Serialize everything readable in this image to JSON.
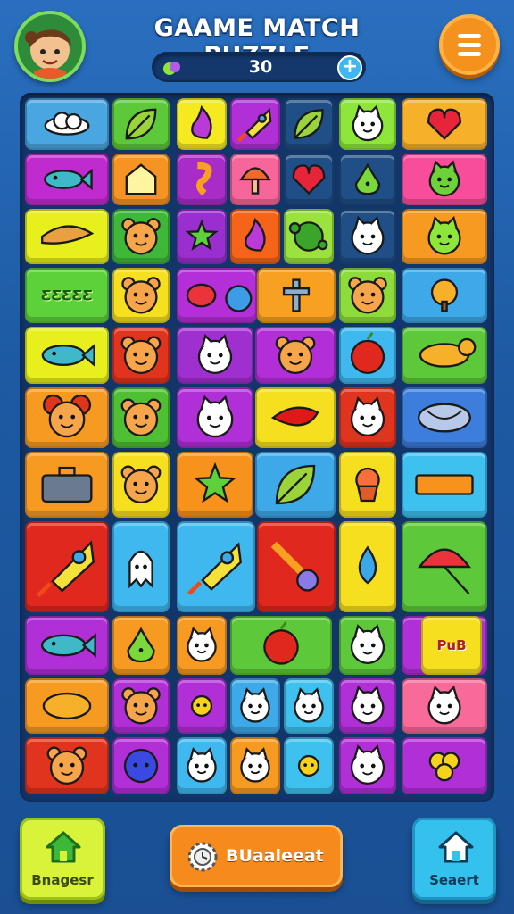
{
  "header": {
    "title": "GAAME MATCH PUZZLE",
    "score": "30",
    "avatar_icon": "cartoon-girl-avatar-icon",
    "menu_icon": "hamburger-menu-icon",
    "add_icon": "plus-icon"
  },
  "colors": {
    "background": "#1f5fa8",
    "board": "#12356a",
    "menu_button": "#f5921e",
    "left_button": "#d9f23a",
    "center_button": "#f78a1c",
    "right_button": "#35c1ee"
  },
  "board": {
    "tiles": [
      {
        "row": 0,
        "color": "#4aa6e0",
        "icon": "cloud-icon"
      },
      {
        "row": 0,
        "color": "#5dc93a",
        "icon": "leaf-icon"
      },
      {
        "row": 0,
        "color": "#f4ea1f",
        "icon": "flame-icon"
      },
      {
        "row": 0,
        "color": "#b02fd6",
        "icon": "rocket-icon"
      },
      {
        "row": 0,
        "color": "#1f4f86",
        "icon": "leaf-icon"
      },
      {
        "row": 0,
        "color": "#8ee63a",
        "icon": "cat-face-icon"
      },
      {
        "row": 0,
        "color": "#f7b02a",
        "icon": "heart-icon"
      },
      {
        "row": 1,
        "color": "#c02bd0",
        "icon": "fish-icon"
      },
      {
        "row": 1,
        "color": "#f59422",
        "icon": "house-icon"
      },
      {
        "row": 1,
        "color": "#a82cc8",
        "icon": "seahorse-icon"
      },
      {
        "row": 1,
        "color": "#f7669a",
        "icon": "mushroom-icon"
      },
      {
        "row": 1,
        "color": "#1f4f86",
        "icon": "heart-icon"
      },
      {
        "row": 1,
        "color": "#1f4f86",
        "icon": "pear-icon"
      },
      {
        "row": 1,
        "color": "#f74d9a",
        "icon": "frog-face-icon"
      },
      {
        "row": 2,
        "color": "#e7f01c",
        "icon": "banana-icon"
      },
      {
        "row": 2,
        "color": "#3fb83a",
        "icon": "bear-face-icon"
      },
      {
        "row": 2,
        "color": "#9a2fd0",
        "icon": "star-icon"
      },
      {
        "row": 2,
        "color": "#f56418",
        "icon": "flame-icon"
      },
      {
        "row": 2,
        "color": "#9be23f",
        "icon": "splash-icon"
      },
      {
        "row": 2,
        "color": "#1f4f86",
        "icon": "ghost-face-icon"
      },
      {
        "row": 2,
        "color": "#f79a22",
        "icon": "monster-face-icon"
      },
      {
        "row": 3,
        "color": "#5dd13a",
        "icon": "text-tile",
        "text": "ƸƸƸƸƸ"
      },
      {
        "row": 3,
        "color": "#f6df1f",
        "icon": "bear-face-icon"
      },
      {
        "row": 3,
        "color": "#b52fd8",
        "icon": "balloon-icon"
      },
      {
        "row": 3,
        "color": "#f7a021",
        "icon": "cross-icon"
      },
      {
        "row": 3,
        "color": "#8edc3c",
        "icon": "bear-face-icon"
      },
      {
        "row": 3,
        "color": "#3da9e8",
        "icon": "tree-icon"
      },
      {
        "row": 4,
        "color": "#e7f01c",
        "icon": "fish-icon"
      },
      {
        "row": 4,
        "color": "#e0341e",
        "icon": "bear-face-icon"
      },
      {
        "row": 4,
        "color": "#a02fd0",
        "icon": "ghost-face-icon"
      },
      {
        "row": 4,
        "color": "#b22fd8",
        "icon": "bear-face-icon"
      },
      {
        "row": 4,
        "color": "#3fb8ef",
        "icon": "apple-icon"
      },
      {
        "row": 4,
        "color": "#5dc93a",
        "icon": "dog-icon"
      },
      {
        "row": 5,
        "color": "#f79a22",
        "icon": "mouse-face-icon"
      },
      {
        "row": 5,
        "color": "#4fbf34",
        "icon": "bear-face-icon"
      },
      {
        "row": 5,
        "color": "#b02fd6",
        "icon": "cat-face-icon"
      },
      {
        "row": 5,
        "color": "#f6df1f",
        "icon": "chili-icon"
      },
      {
        "row": 5,
        "color": "#e0341e",
        "icon": "cat-face-icon"
      },
      {
        "row": 5,
        "color": "#3d7ddb",
        "icon": "yarn-icon"
      },
      {
        "row": 6,
        "color": "#f79a22",
        "icon": "briefcase-icon"
      },
      {
        "row": 6,
        "color": "#f6df1f",
        "icon": "bear-face-icon"
      },
      {
        "row": 6,
        "color": "#f7931c",
        "icon": "star-icon"
      },
      {
        "row": 6,
        "color": "#3da9e8",
        "icon": "leaf-icon"
      },
      {
        "row": 6,
        "color": "#f6df1f",
        "icon": "cupcake-icon"
      },
      {
        "row": 6,
        "color": "#3fc1ef",
        "icon": "sign-icon"
      },
      {
        "row": 7,
        "color": "#e0281e",
        "icon": "rocket-icon"
      },
      {
        "row": 7,
        "color": "#3fb8ef",
        "icon": "ghost-icon"
      },
      {
        "row": 7,
        "color": "#3fb8ef",
        "icon": "rocket-icon"
      },
      {
        "row": 7,
        "color": "#e0281e",
        "icon": "hand-icon"
      },
      {
        "row": 7,
        "color": "#f6df1f",
        "icon": "drop-icon"
      },
      {
        "row": 7,
        "color": "#5dc93a",
        "icon": "umbrella-icon"
      },
      {
        "row": 8,
        "color": "#b02fd6",
        "icon": "fish-icon"
      },
      {
        "row": 8,
        "color": "#f79a22",
        "icon": "pear-icon"
      },
      {
        "row": 8,
        "color": "#f79a22",
        "icon": "ghost-face-icon"
      },
      {
        "row": 8,
        "color": "#5dc93a",
        "icon": "apple-icon"
      },
      {
        "row": 8,
        "color": "#5dc93a",
        "icon": "cat-face-icon"
      },
      {
        "row": 8,
        "color": "#b02fd6",
        "icon": "frog-face-icon"
      },
      {
        "row": 8,
        "color": "#f6df1f",
        "icon": "text-tile",
        "text": "PuB"
      },
      {
        "row": 9,
        "color": "#f79a22",
        "icon": "turtle-icon"
      },
      {
        "row": 9,
        "color": "#b02fd6",
        "icon": "bear-face-icon"
      },
      {
        "row": 9,
        "color": "#b02fd6",
        "icon": "sun-icon"
      },
      {
        "row": 9,
        "color": "#3da9e8",
        "icon": "ghost-face-icon"
      },
      {
        "row": 9,
        "color": "#3fc1ef",
        "icon": "cat-face-icon"
      },
      {
        "row": 9,
        "color": "#b02fd6",
        "icon": "ghost-face-icon"
      },
      {
        "row": 9,
        "color": "#f76a9a",
        "icon": "ghost-face-icon"
      },
      {
        "row": 10,
        "color": "#e0341e",
        "icon": "bear-face-icon"
      },
      {
        "row": 10,
        "color": "#b02fd6",
        "icon": "blueberry-icon"
      },
      {
        "row": 10,
        "color": "#3fb8ef",
        "icon": "ghost-face-icon"
      },
      {
        "row": 10,
        "color": "#f79a22",
        "icon": "ghost-face-icon"
      },
      {
        "row": 10,
        "color": "#3fc1ef",
        "icon": "sun-icon"
      },
      {
        "row": 10,
        "color": "#b02fd6",
        "icon": "ghost-face-icon"
      },
      {
        "row": 10,
        "color": "#b02fd6",
        "icon": "flower-icon"
      }
    ]
  },
  "footer": {
    "left_label": "Bnagesr",
    "left_icon": "home-icon",
    "center_label": "BUaaleeat",
    "center_icon": "gear-clock-icon",
    "right_label": "Seaert",
    "right_icon": "home-icon"
  }
}
